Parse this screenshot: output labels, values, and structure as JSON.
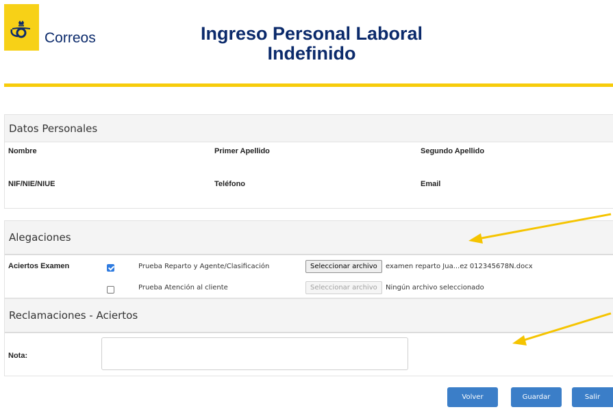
{
  "header": {
    "logo_text": "Correos",
    "title_line1": "Ingreso Personal Laboral",
    "title_line2": "Indefinido"
  },
  "datos_personales": {
    "title": "Datos Personales",
    "fields": {
      "nombre": "Nombre",
      "primer_apellido": "Primer Apellido",
      "segundo_apellido": "Segundo Apellido",
      "nif": "NIF/NIE/NIUE",
      "telefono": "Teléfono",
      "email": "Email"
    }
  },
  "alegaciones": {
    "title": "Alegaciones",
    "row_label": "Aciertos Examen",
    "items": [
      {
        "checked": true,
        "label": "Prueba Reparto y Agente/Clasificación",
        "button": "Seleccionar archivo",
        "file": "examen reparto Jua...ez 012345678N.docx"
      },
      {
        "checked": false,
        "label": "Prueba Atención al cliente",
        "button": "Seleccionar archivo",
        "file": "Ningún archivo seleccionado"
      }
    ]
  },
  "reclamaciones": {
    "title": "Reclamaciones - Aciertos",
    "nota_label": "Nota:"
  },
  "buttons": {
    "volver": "Volver",
    "guardar": "Guardar",
    "salir": "Salir"
  },
  "colors": {
    "brand_yellow": "#f7d117",
    "brand_blue": "#0b2a6b",
    "button_blue": "#3b7ec8",
    "arrow_yellow": "#f5c400"
  }
}
